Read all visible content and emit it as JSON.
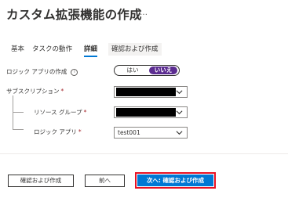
{
  "header": {
    "title": "カスタム拡張機能の作成",
    "more": "…"
  },
  "tabs": [
    {
      "label": "基本"
    },
    {
      "label": "タスクの動作"
    },
    {
      "label": "詳細"
    },
    {
      "label": "確認および作成"
    }
  ],
  "form": {
    "logic_app_create": {
      "label": "ロジック アプリの作成",
      "info_icon": "info-icon",
      "options": [
        "はい",
        "いいえ"
      ],
      "selected": "いいえ"
    },
    "subscription": {
      "label": "サブスクリプション",
      "required_mark": "*"
    },
    "resource_group": {
      "label": "リソース グループ",
      "required_mark": "*"
    },
    "logic_app": {
      "label": "ロジック アプリ",
      "required_mark": "*",
      "value": "test001"
    }
  },
  "footer": {
    "review_create": "確認および作成",
    "previous": "前へ",
    "next_review": "次へ: 確認および作成"
  },
  "colors": {
    "accent": "#0078d4",
    "toggle_selected": "#5c2d91",
    "highlight_border": "#e81123"
  }
}
